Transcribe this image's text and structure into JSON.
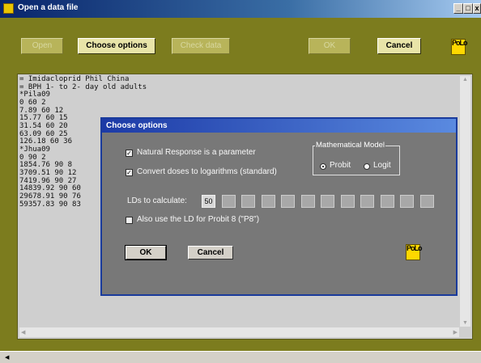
{
  "window": {
    "title": "Open a data file",
    "controls": {
      "minimize": "_",
      "maximize": "□",
      "close": "x"
    }
  },
  "toolbar": {
    "open_label": "Open",
    "choose_options_label": "Choose options",
    "check_data_label": "Check data",
    "ok_label": "OK",
    "cancel_label": "Cancel"
  },
  "logo": {
    "text": "PoLo"
  },
  "data_file": {
    "lines": [
      "= Imidacloprid Phil China",
      "= BPH 1- to 2- day old adults",
      "*Pila09",
      "0 60 2",
      "7.89 60 12",
      "15.77 60 15",
      "31.54 60 20",
      "63.09 60 25",
      "126.18 60 36",
      "*Jhua09",
      "0 90 2",
      "1854.76 90 8",
      "3709.51 90 12",
      "7419.96 90 27",
      "14839.92 90 60",
      "29678.91 90 76",
      "59357.83 90 83"
    ]
  },
  "dialog": {
    "title": "Choose options",
    "natural_response_label": "Natural Response is a parameter",
    "natural_response_checked": true,
    "convert_doses_label": "Convert doses to logarithms (standard)",
    "convert_doses_checked": true,
    "model_group_label": "Mathematical Model",
    "model_options": [
      "Probit",
      "Logit"
    ],
    "model_selected": "Probit",
    "lds_label": "LDs to calculate:",
    "lds_values": [
      "50",
      "",
      "",
      "",
      "",
      "",
      "",
      "",
      "",
      "",
      "",
      ""
    ],
    "probit8_label": "Also use the LD for Probit 8 (\"P8\")",
    "probit8_checked": false,
    "ok_label": "OK",
    "cancel_label": "Cancel"
  },
  "colors": {
    "window_bg": "#7c7c1e",
    "dialog_bg": "#787878",
    "dialog_title": "#1c3aa6",
    "logo_yellow": "#ffd800"
  }
}
